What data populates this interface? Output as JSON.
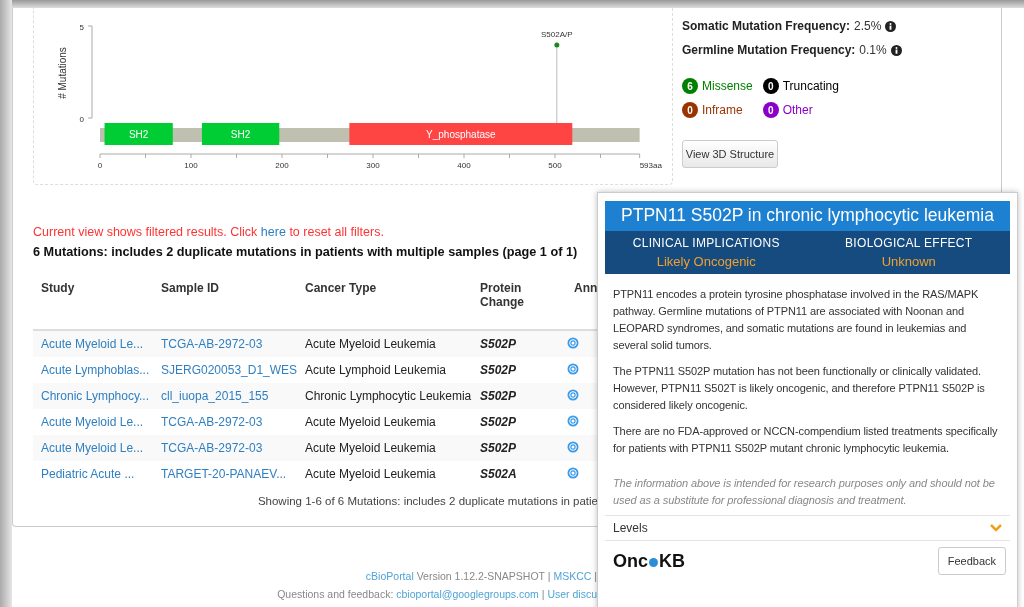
{
  "lollipop_plot": {
    "ylabel": "# Mutations",
    "yticks": [
      "5",
      "0"
    ],
    "xticks": [
      "0",
      "100",
      "200",
      "300",
      "400",
      "500",
      "593aa"
    ],
    "mutation_label": "S502A/P",
    "domains": [
      {
        "label": "SH2",
        "color": "#00cc33"
      },
      {
        "label": "SH2",
        "color": "#00cc33"
      },
      {
        "label": "Y_phosphatase",
        "color": "#ff4444"
      }
    ]
  },
  "frequencies": [
    {
      "label": "Somatic Mutation Frequency:",
      "value": "2.5%"
    },
    {
      "label": "Germline Mutation Frequency:",
      "value": "0.1%"
    }
  ],
  "mutation_types": [
    {
      "count": "6",
      "label": "Missense",
      "color": "#008000"
    },
    {
      "count": "0",
      "label": "Truncating",
      "color": "#000000"
    },
    {
      "count": "0",
      "label": "Inframe",
      "color": "#993300"
    },
    {
      "count": "0",
      "label": "Other",
      "color": "#8b00c9"
    }
  ],
  "view_3d_button": "View 3D Structure",
  "filter_notice": {
    "before": "Current view shows filtered results. Click",
    "link": "here",
    "after": "to reset all filters."
  },
  "table": {
    "title": "6 Mutations: includes 2 duplicate mutations in patients with multiple samples (page 1 of 1)",
    "columns": [
      "Study",
      "Sample ID",
      "Cancer Type",
      "Protein Change",
      "Ann"
    ],
    "rows": [
      {
        "study": "Acute Myeloid Le...",
        "sample": "TCGA-AB-2972-03",
        "cancer_type": "Acute Myeloid Leukemia",
        "protein_change": "S502P"
      },
      {
        "study": "Acute Lymphoblas...",
        "sample": "SJERG020053_D1_WES",
        "cancer_type": "Acute Lymphoid Leukemia",
        "protein_change": "S502P"
      },
      {
        "study": "Chronic Lymphocy...",
        "sample": "cll_iuopa_2015_155",
        "cancer_type": "Chronic Lymphocytic Leukemia",
        "protein_change": "S502P"
      },
      {
        "study": "Acute Myeloid Le...",
        "sample": "TCGA-AB-2972-03",
        "cancer_type": "Acute Myeloid Leukemia",
        "protein_change": "S502P"
      },
      {
        "study": "Acute Myeloid Le...",
        "sample": "TCGA-AB-2972-03",
        "cancer_type": "Acute Myeloid Leukemia",
        "protein_change": "S502P"
      },
      {
        "study": "Pediatric Acute ...",
        "sample": "TARGET-20-PANAEV...",
        "cancer_type": "Acute Myeloid Leukemia",
        "protein_change": "S502A"
      }
    ],
    "summary": "Showing 1-6 of 6 Mutations: includes 2 duplicate mutations in patie"
  },
  "footer": {
    "line1": [
      {
        "text": "cBioPortal",
        "link": true
      },
      {
        "text": "Version 1.12.2-SNAPSHOT |",
        "link": false
      },
      {
        "text": "MSKCC",
        "link": true
      },
      {
        "text": "|",
        "link": false
      }
    ],
    "line2": [
      {
        "text": "Questions and feedback:",
        "link": false
      },
      {
        "text": "cbioportal@googlegroups.com",
        "link": true
      },
      {
        "text": "|",
        "link": false
      },
      {
        "text": "User discu",
        "link": true
      }
    ]
  },
  "oncokb_card": {
    "title": "PTPN11 S502P in chronic lymphocytic leukemia",
    "sections": [
      {
        "heading": "CLINICAL IMPLICATIONS",
        "value": "Likely Oncogenic"
      },
      {
        "heading": "BIOLOGICAL EFFECT",
        "value": "Unknown"
      }
    ],
    "paragraphs": [
      "PTPN11 encodes a protein tyrosine phosphatase involved in the RAS/MAPK pathway. Germline mutations of PTPN11 are associated with Noonan and LEOPARD syndromes, and somatic mutations are found in leukemias and several solid tumors.",
      "The PTPN11 S502P mutation has not been functionally or clinically validated. However, PTPN11 S502T is likely oncogenic, and therefore PTPN11 S502P is considered likely oncogenic.",
      "There are no FDA-approved or NCCN-compendium listed treatments specifically for patients with PTPN11 S502P mutant chronic lymphocytic leukemia."
    ],
    "disclaimer": "The information above is intended for research purposes only and should not be used as a substitute for professional diagnosis and treatment.",
    "levels": {
      "label": "Levels",
      "expanded": false
    },
    "logo": {
      "before": "Onc",
      "after": "KB"
    },
    "feedback_button": "Feedback"
  }
}
